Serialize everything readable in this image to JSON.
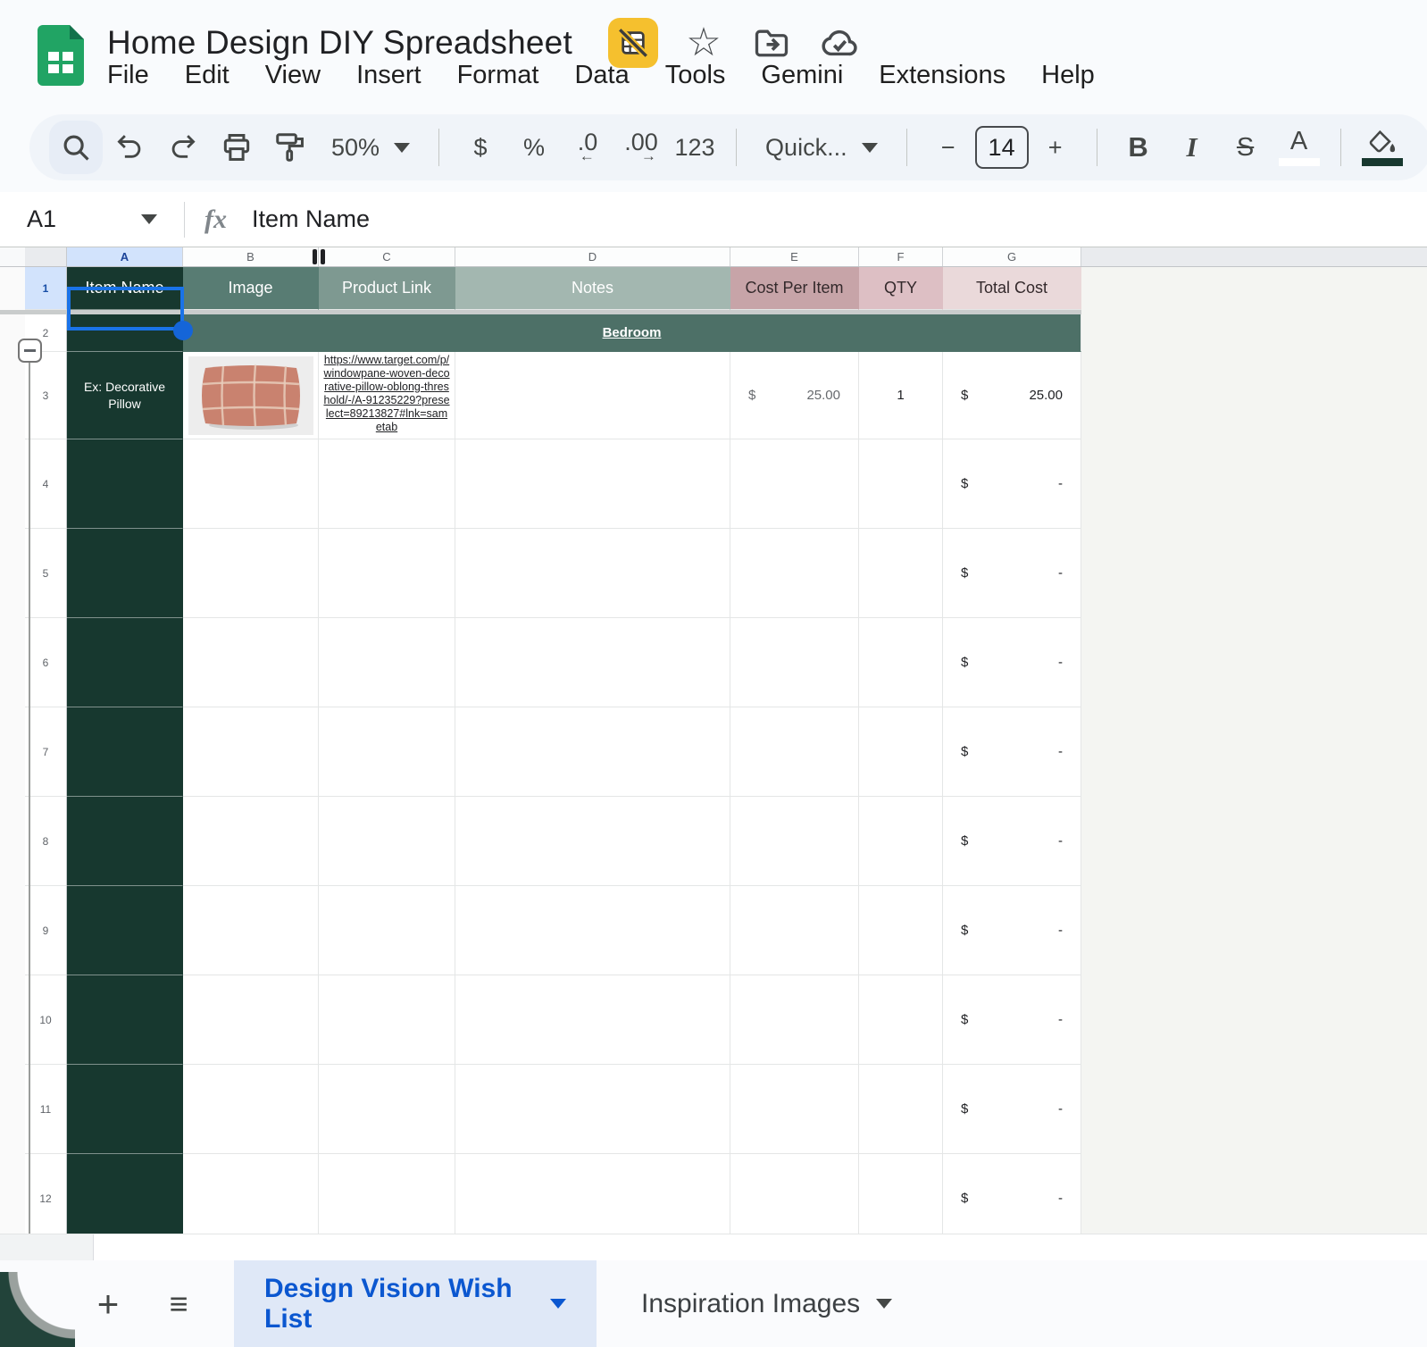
{
  "header": {
    "title": "Home Design DIY Spreadsheet",
    "menus": [
      "File",
      "Edit",
      "View",
      "Insert",
      "Format",
      "Data",
      "Tools",
      "Gemini",
      "Extensions",
      "Help"
    ]
  },
  "icons": {
    "star": "☆",
    "all_sheets_menu": "≡",
    "add_sheet": "+",
    "bold": "B",
    "italic": "I",
    "strikethrough": "S",
    "text_color": "A"
  },
  "toolbar": {
    "zoom_value": "50%",
    "currency": "$",
    "percent": "%",
    "decrease_decimal": ".0",
    "decrease_decimal_arrow": "←",
    "increase_decimal": ".00",
    "increase_decimal_arrow": "→",
    "more_formats": "123",
    "font_name": "Quick...",
    "minus": "−",
    "font_size": "14",
    "plus": "+"
  },
  "formula_bar": {
    "cell_ref": "A1",
    "fx_label": "fx",
    "value": "Item Name"
  },
  "grid": {
    "column_letters": [
      "A",
      "B",
      "C",
      "D",
      "E",
      "F",
      "G"
    ],
    "rows": {
      "header": {
        "n": "1",
        "item_name": "Item Name",
        "image": "Image",
        "product_link": "Product Link",
        "notes": "Notes",
        "cost_per_item": "Cost Per Item",
        "qty": "QTY",
        "total_cost": "Total Cost"
      },
      "section": {
        "n": "2",
        "label": "Bedroom"
      },
      "example": {
        "n": "3",
        "item_name": "Ex: Decorative Pillow",
        "product_link": "https://www.target.com/p/windowpane-woven-decorative-pillow-oblong-threshold/-/A-91235229?preselect=89213827#lnk=sametab",
        "cost_symbol": "$",
        "cost_value": "25.00",
        "qty": "1",
        "total_symbol": "$",
        "total_value": "25.00"
      },
      "empty": {
        "numbers": [
          "4",
          "5",
          "6",
          "7",
          "8",
          "9",
          "10",
          "11",
          "12"
        ],
        "total_symbol": "$",
        "total_value": "-"
      }
    }
  },
  "tabs": {
    "active": "Design Vision Wish List",
    "inactive": "Inspiration Images"
  },
  "colors": {
    "selection_blue": "#1a73e8",
    "column_a_green": "#17382f",
    "section_band_green": "#4d7067",
    "active_tab_blue": "#0b57d0",
    "badge_yellow": "#f5c02e"
  }
}
